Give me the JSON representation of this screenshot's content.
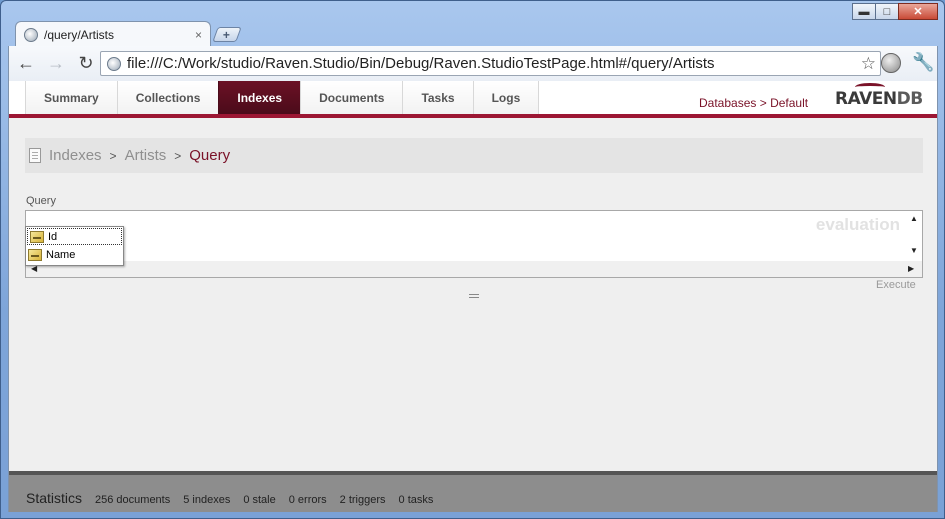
{
  "browser": {
    "tab_title": "/query/Artists",
    "tab_close": "×",
    "new_tab": "+",
    "url": "file:///C:/Work/studio/Raven.Studio/Bin/Debug/Raven.StudioTestPage.html#/query/Artists",
    "window_controls": {
      "minimize": "▬",
      "maximize": "□",
      "close": "✕"
    },
    "nav": {
      "back": "←",
      "forward": "→",
      "reload": "↻",
      "star": "☆",
      "wrench": "🔧"
    }
  },
  "nav": {
    "tabs": [
      {
        "label": "Summary"
      },
      {
        "label": "Collections"
      },
      {
        "label": "Indexes"
      },
      {
        "label": "Documents"
      },
      {
        "label": "Tasks"
      },
      {
        "label": "Logs"
      }
    ],
    "active_tab": "Indexes",
    "databases_label": "Databases",
    "crumb_sep": ">",
    "database_name": "Default",
    "logo": {
      "part1": "RAVEN",
      "part2": "DB"
    }
  },
  "breadcrumb": {
    "items": [
      "Indexes",
      "Artists"
    ],
    "current": "Query",
    "sep": ">"
  },
  "query": {
    "label": "Query",
    "watermark": "evaluation",
    "suggestions": [
      "Id",
      "Name"
    ],
    "execute_label": "Execute",
    "splitter": "="
  },
  "stats": {
    "title": "Statistics",
    "documents": "256 documents",
    "indexes": "5 indexes",
    "stale": "0 stale",
    "errors": "0 errors",
    "triggers": "2 triggers",
    "tasks": "0 tasks"
  },
  "colors": {
    "accent": "#7a1228",
    "active_tab": "#5b0e1f",
    "stats_bar": "#8d8d8d"
  }
}
